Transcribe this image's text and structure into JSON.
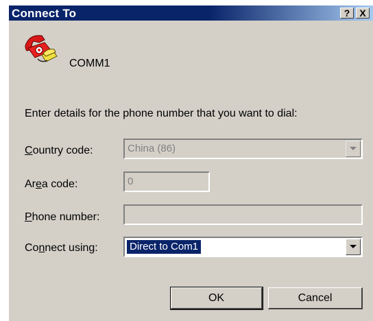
{
  "window": {
    "title": "Connect To",
    "help_label": "?",
    "close_label": "X"
  },
  "connection": {
    "name": "COMM1",
    "icon": "phone-icon"
  },
  "instructions": "Enter details for the phone number that you want to dial:",
  "fields": {
    "country": {
      "pre": "",
      "mnemonic": "C",
      "post": "ountry code:",
      "value": "China (86)"
    },
    "area": {
      "pre": "Ar",
      "mnemonic": "e",
      "post": "a code:",
      "value": "0"
    },
    "phone": {
      "pre": "",
      "mnemonic": "P",
      "post": "hone number:",
      "value": ""
    },
    "connect": {
      "pre": "Co",
      "mnemonic": "n",
      "post": "nect using:",
      "value": "Direct to Com1"
    }
  },
  "buttons": {
    "ok": "OK",
    "cancel": "Cancel"
  },
  "colors": {
    "titlebar": "#0a246a",
    "dialog_bg": "#d4d0c8",
    "selection": "#0a246a"
  }
}
